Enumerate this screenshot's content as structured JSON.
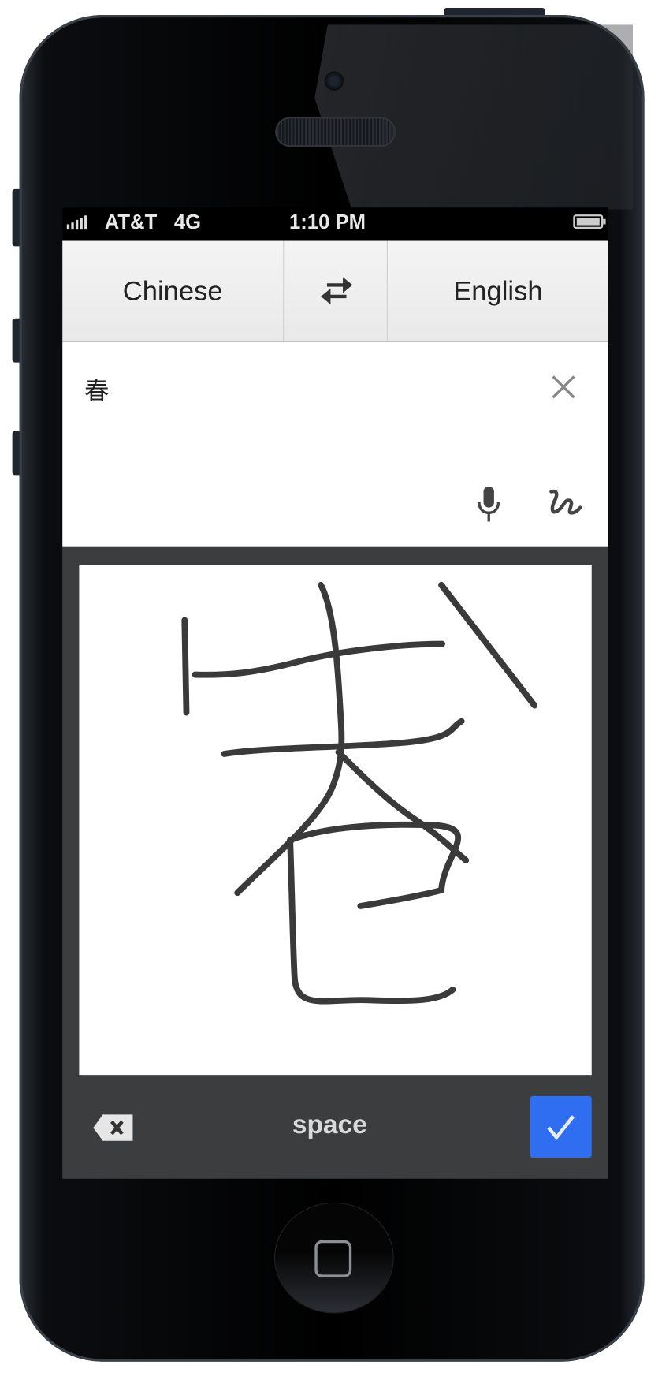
{
  "status_bar": {
    "carrier": "AT&T",
    "network": "4G",
    "time": "1:10 PM",
    "signal_bars": 5,
    "battery_level": 1.0
  },
  "header": {
    "source_language": "Chinese",
    "target_language": "English",
    "swap_icon": "swap-arrows-icon"
  },
  "input": {
    "text": "春",
    "clear_icon": "close-x-icon",
    "mic_icon": "microphone-icon",
    "handwriting_icon": "handwriting-squiggle-icon"
  },
  "keyboard": {
    "backspace_icon": "backspace-icon",
    "space_label": "space",
    "confirm_icon": "checkmark-icon"
  },
  "colors": {
    "accent": "#2f6ef0",
    "panel": "#3c3d3f",
    "stroke": "#3a3a3a"
  }
}
